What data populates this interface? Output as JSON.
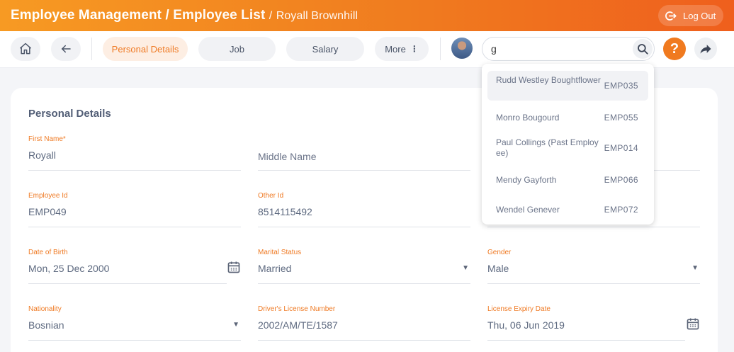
{
  "header": {
    "module": "Employee Management",
    "separator": "/",
    "crumb": "Employee List",
    "separator2": "/",
    "current": "Royall Brownhill",
    "logout_label": "Log Out"
  },
  "toolbar": {
    "tabs": [
      "Personal Details",
      "Job",
      "Salary",
      "More"
    ],
    "active_tab": "Personal Details",
    "search_value": "g",
    "help_label": "?"
  },
  "form": {
    "title": "Personal Details",
    "first_name_label": "First Name*",
    "first_name_value": "Royall",
    "middle_name_placeholder": "Middle Name",
    "employee_id_label": "Employee Id",
    "employee_id_value": "EMP049",
    "other_id_label": "Other Id",
    "other_id_value": "8514115492",
    "dob_label": "Date of Birth",
    "dob_value": "Mon, 25 Dec 2000",
    "marital_label": "Marital Status",
    "marital_value": "Married",
    "gender_label": "Gender",
    "gender_value": "Male",
    "nationality_label": "Nationality",
    "nationality_value": "Bosnian",
    "license_label": "Driver's License Number",
    "license_value": "2002/AM/TE/1587",
    "license_expiry_label": "License Expiry Date",
    "license_expiry_value": "Thu, 06 Jun 2019"
  },
  "search_results": [
    {
      "name": "Rudd Westley Boughtflower",
      "id": "EMP035",
      "highlighted": true
    },
    {
      "name": "Monro Bougourd",
      "id": "EMP055",
      "highlighted": false
    },
    {
      "name": "Paul Collings (Past Employee)",
      "id": "EMP014",
      "highlighted": false
    },
    {
      "name": "Mendy Gayforth",
      "id": "EMP066",
      "highlighted": false
    },
    {
      "name": "Wendel Genever",
      "id": "EMP072",
      "highlighted": false
    }
  ],
  "colors": {
    "accent": "#f07a1f",
    "label": "#ef7a24"
  }
}
